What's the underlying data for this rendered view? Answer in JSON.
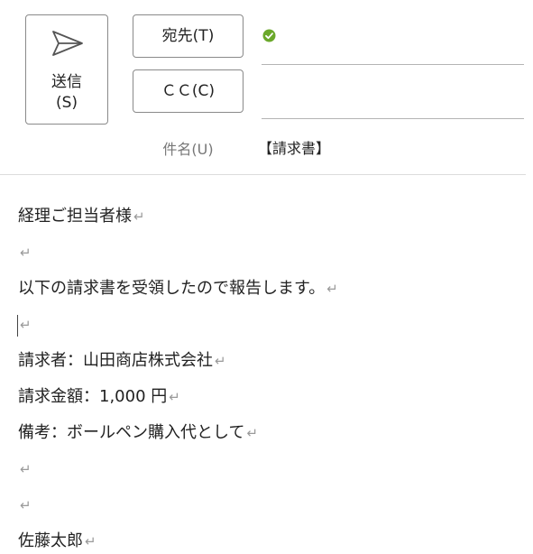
{
  "toolbar": {
    "send_label_main": "送信",
    "send_label_key": "(S)",
    "send_icon": "paper-plane-icon"
  },
  "fields": {
    "to_label": "宛先(T)",
    "to_value": "",
    "to_status_icon": "check-circle-icon",
    "to_status_color": "#6aa82a",
    "cc_label": "ＣＣ(C)",
    "cc_value": "",
    "subject_label": "件名(U)",
    "subject_value": "【請求書】"
  },
  "body": {
    "return_mark": "↵",
    "lines": [
      "経理ご担当者様",
      "",
      "以下の請求書を受領したので報告します。",
      "",
      "請求者：山田商店株式会社",
      "請求金額：1,000 円",
      "備考：ボールペン購入代として",
      "",
      "",
      "佐藤太郎"
    ]
  }
}
